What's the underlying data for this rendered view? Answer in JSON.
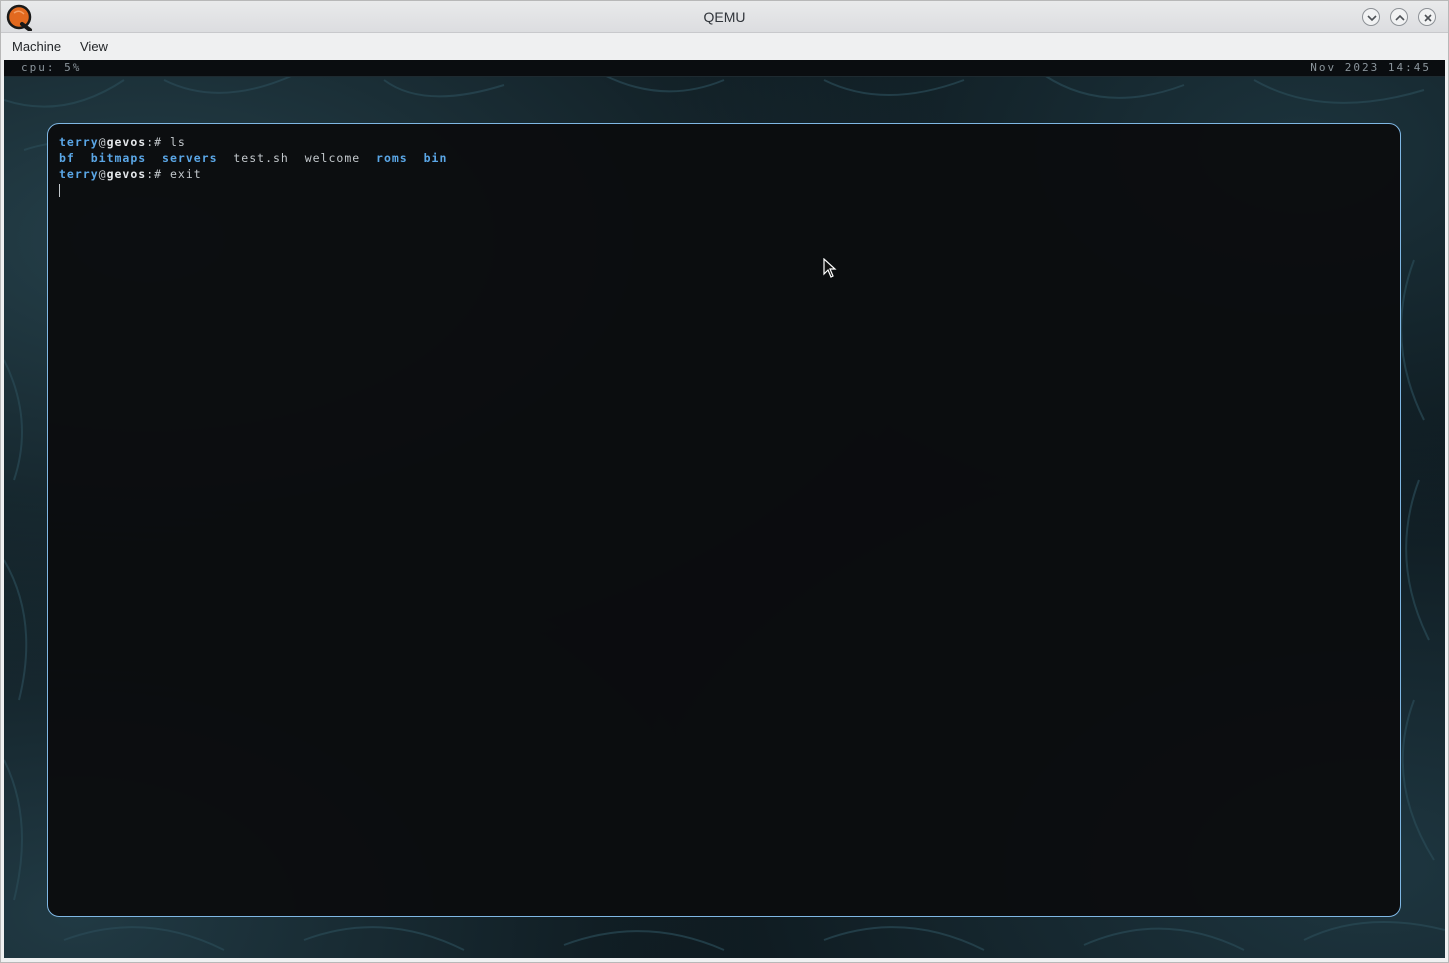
{
  "window": {
    "title": "QEMU",
    "controls": [
      "chevron-down-icon",
      "chevron-up-icon",
      "close-icon"
    ]
  },
  "menubar": {
    "items": [
      {
        "label": "Machine"
      },
      {
        "label": "View"
      }
    ]
  },
  "status": {
    "cpu_label": "cpu:",
    "cpu_value": "5%",
    "datetime": "Nov 2023 14:45"
  },
  "terminal": {
    "lines": [
      {
        "user": "terry",
        "at": "@",
        "host": "gevos",
        "prompt": ":# ",
        "command": "ls"
      },
      {
        "entries": [
          {
            "name": "bf",
            "kind": "dir"
          },
          {
            "name": "bitmaps",
            "kind": "dir"
          },
          {
            "name": "servers",
            "kind": "dir"
          },
          {
            "name": "test.sh",
            "kind": "file"
          },
          {
            "name": "welcome",
            "kind": "file"
          },
          {
            "name": "roms",
            "kind": "dir"
          },
          {
            "name": "bin",
            "kind": "dir"
          }
        ]
      },
      {
        "user": "terry",
        "at": "@",
        "host": "gevos",
        "prompt": ":# ",
        "command": "exit"
      }
    ]
  },
  "colors": {
    "accent_blue": "#5aa6e6",
    "terminal_border": "#7fb7e4",
    "terminal_bg": "#0b0d0f"
  }
}
